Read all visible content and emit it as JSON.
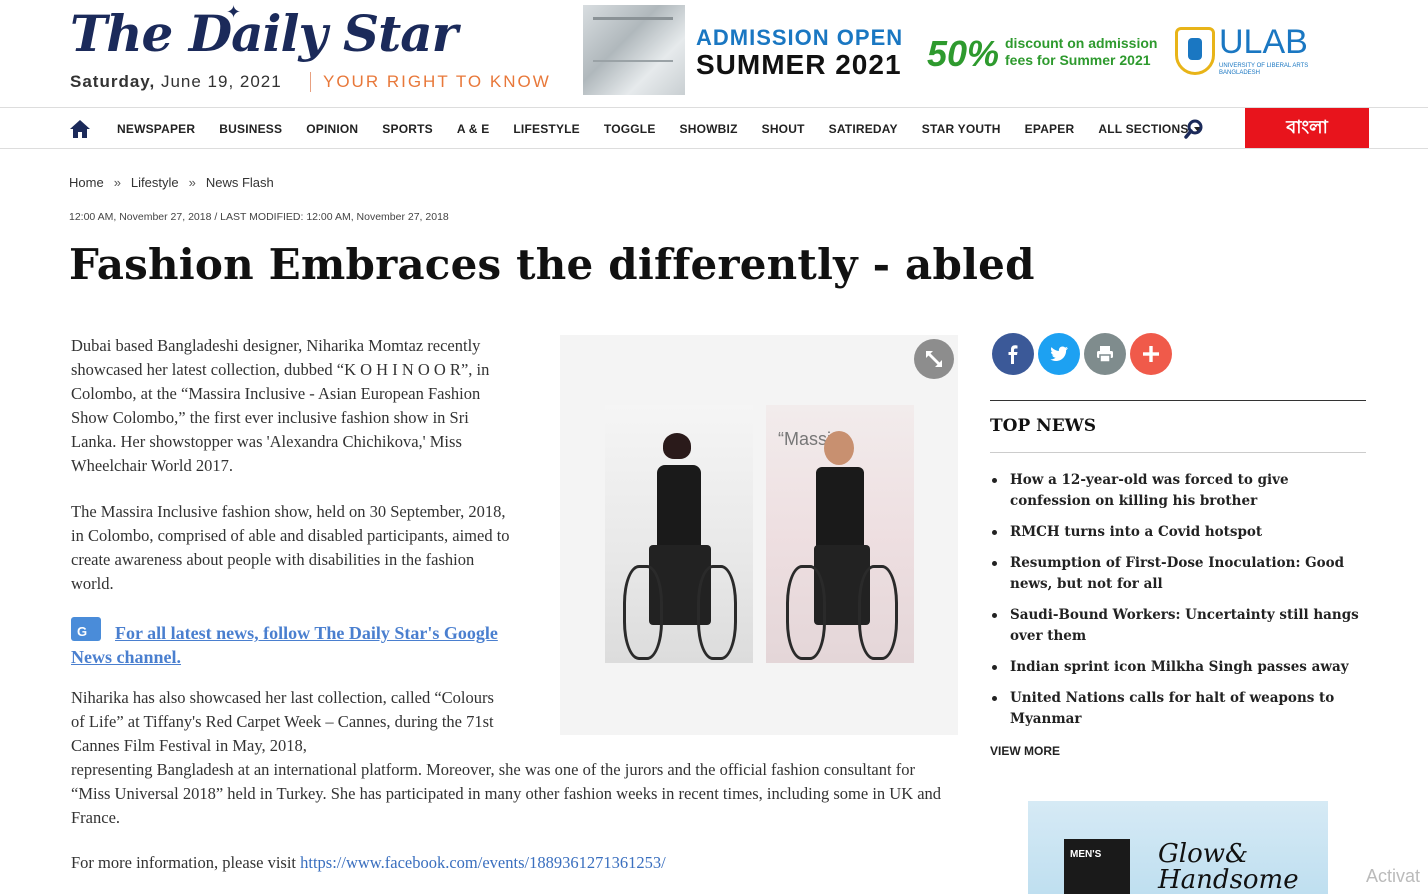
{
  "header": {
    "logo": "The Daily Star",
    "date_day": "Saturday,",
    "date_rest": "June 19, 2021",
    "tagline": "YOUR RIGHT TO KNOW"
  },
  "ad": {
    "admission": "ADMISSION OPEN",
    "summer": "SUMMER 2021",
    "percent": "50%",
    "discount": "discount on admission fees for Summer 2021",
    "brand": "ULAB",
    "brand_sub": "UNIVERSITY OF LIBERAL ARTS BANGLADESH"
  },
  "nav": {
    "items": [
      "NEWSPAPER",
      "BUSINESS",
      "OPINION",
      "SPORTS",
      "A & E",
      "LIFESTYLE",
      "TOGGLE",
      "SHOWBIZ",
      "SHOUT",
      "SATIREDAY",
      "STAR YOUTH",
      "EPAPER"
    ],
    "all_sections": "ALL SECTIONS",
    "bangla": "বাংলা"
  },
  "breadcrumb": [
    "Home",
    "Lifestyle",
    "News Flash"
  ],
  "timestamp": "12:00 AM, November 27, 2018 / LAST MODIFIED: 12:00 AM, November 27, 2018",
  "headline": "Fashion Embraces the differently - abled",
  "article": {
    "p1": "Dubai based Bangladeshi designer, Niharika Momtaz recently showcased her latest collection, dubbed “K O H I N O O R”, in Colombo, at the “Massira Inclusive - Asian European Fashion Show Colombo,” the first ever inclusive fashion show in Sri Lanka. Her showstopper was 'Alexandra Chichikova,' Miss Wheelchair World 2017.",
    "p2": "The Massira Inclusive fashion show, held on 30 September, 2018, in Colombo, comprised of able and disabled participants, aimed to create awareness about people with disabilities in the fashion world.",
    "gnews": "For all latest news, follow The Daily Star's Google News channel.",
    "p3a": "Niharika has also showcased her last collection, called “Colours of Life” at Tiffany's Red Carpet Week – Cannes, during the 71st Cannes Film Festival in May, 2018,",
    "p3b": "representing Bangladesh at an international platform. Moreover, she was one of the jurors and the official fashion consultant for “Miss Universal 2018” held in Turkey. She has participated in many other fashion weeks in recent times, including some in UK and France.",
    "p4_prefix": "For more information, please visit ",
    "p4_link": "https://www.facebook.com/events/1889361271361253/"
  },
  "photo": {
    "backdrop_text": "“Massi"
  },
  "sidebar": {
    "top_news_title": "TOP NEWS",
    "news": [
      "How a 12-year-old was forced to give confession on killing his brother",
      "RMCH turns into a Covid hotspot",
      "Resumption of First-Dose Inoculation: Good news, but not for all",
      "Saudi-Bound Workers: Uncertainty still hangs over them",
      "Indian sprint icon Milkha Singh passes away",
      "United Nations calls for halt of weapons to Myanmar"
    ],
    "view_more": "VIEW MORE",
    "share_colors": {
      "facebook": "#3b5998",
      "twitter": "#1da1f2",
      "print": "#7f8c8d",
      "more": "#f05a4a"
    }
  },
  "side_ad": {
    "product": "MEN'S",
    "title_1": "Glow&",
    "title_2": "Handsome"
  },
  "watermark": "Activat",
  "colors": {
    "accent_red": "#e8141c",
    "tagline_orange": "#e8783a",
    "link_blue": "#4a7fcf"
  }
}
